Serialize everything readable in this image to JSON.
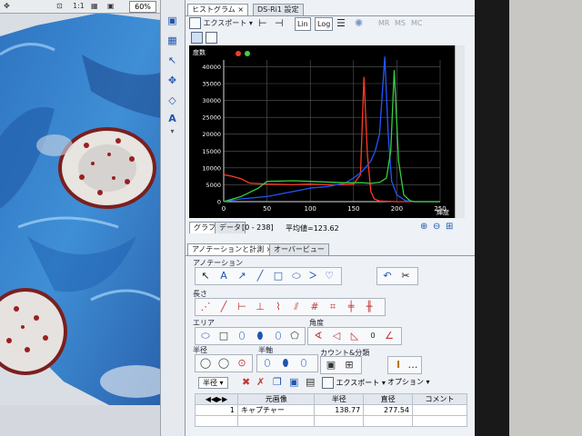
{
  "viewer": {
    "fit_label": "1:1",
    "zoom_value": "60%"
  },
  "tabs": {
    "histogram": "ヒストグラム",
    "ds_settings": "DS-Ri1 設定",
    "close": "×"
  },
  "toolbar": {
    "export_label": "エクスポート",
    "lin_label": "Lin",
    "log_label": "Log",
    "mr": "MR",
    "ms": "MS",
    "mc": "MC"
  },
  "histogram": {
    "ylabel": "度数",
    "xlabel": "輝度",
    "legend_dot_colors": [
      "#e8402a",
      "#3bd04b"
    ],
    "graph_tab": "グラフ",
    "data_tab": "データ",
    "range_label": "[0 - 238]",
    "mean_label": "平均値=123.62"
  },
  "chart_data": {
    "type": "line",
    "title": "",
    "xlabel": "輝度",
    "ylabel": "度数",
    "xlim": [
      0,
      250
    ],
    "ylim": [
      0,
      42000
    ],
    "x_ticks": [
      0,
      50,
      100,
      150,
      200,
      250
    ],
    "y_ticks": [
      0,
      5000,
      10000,
      15000,
      20000,
      25000,
      30000,
      35000,
      40000
    ],
    "grid": true,
    "series": [
      {
        "color": "#ff3b22",
        "x": [
          0,
          10,
          20,
          30,
          50,
          80,
          100,
          120,
          140,
          150,
          158,
          162,
          166,
          170,
          174,
          180,
          200,
          250
        ],
        "y": [
          8000,
          7500,
          6800,
          5500,
          5200,
          5000,
          5200,
          5000,
          5000,
          5200,
          8000,
          37000,
          14000,
          3000,
          800,
          200,
          0,
          0
        ]
      },
      {
        "color": "#2255ff",
        "x": [
          0,
          20,
          50,
          80,
          100,
          120,
          140,
          150,
          160,
          170,
          175,
          180,
          186,
          190,
          194,
          200,
          210,
          220,
          250
        ],
        "y": [
          0,
          800,
          1500,
          3000,
          4000,
          4500,
          5500,
          7000,
          9000,
          12000,
          15000,
          20000,
          43000,
          20000,
          6000,
          2000,
          300,
          0,
          0
        ]
      },
      {
        "color": "#33d040",
        "x": [
          0,
          20,
          40,
          50,
          80,
          100,
          140,
          160,
          170,
          180,
          188,
          193,
          197,
          202,
          208,
          215,
          220,
          250
        ],
        "y": [
          0,
          1500,
          4000,
          6000,
          6200,
          6000,
          5600,
          5600,
          5400,
          5700,
          7000,
          15000,
          39000,
          12000,
          2000,
          300,
          0,
          0
        ]
      }
    ]
  },
  "annotation": {
    "tab_label": "アノテーションと計測",
    "overview_tab": "オーバービュー",
    "annotation_section": "アノテーション",
    "length_section": "長さ",
    "area_section": "エリア",
    "angle_section": "角度",
    "radius_section": "半径",
    "halfaxis_section": "半軸",
    "count_section": "カウント&分類",
    "count_value": "0"
  },
  "measurement": {
    "mode_label": "半径",
    "export_label": "エクスポート",
    "options_label": "オプション",
    "columns": [
      "◀◀▶▶",
      "元画像",
      "半径",
      "直径",
      "コメント"
    ],
    "rows": [
      [
        "1",
        "キャプチャー",
        "138.77",
        "277.54",
        ""
      ]
    ]
  }
}
